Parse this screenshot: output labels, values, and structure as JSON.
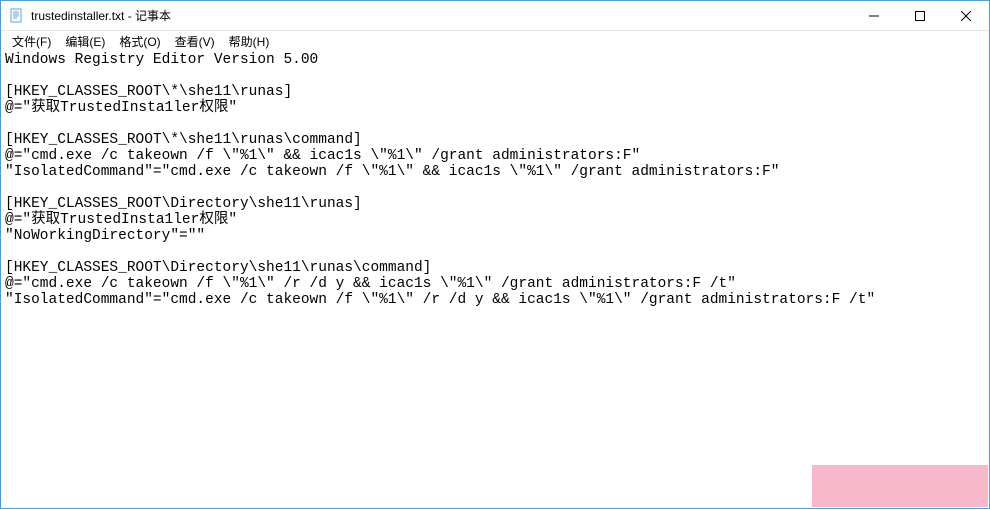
{
  "window": {
    "title": "trustedinstaller.txt - 记事本"
  },
  "menu": {
    "file": "文件(F)",
    "edit": "编辑(E)",
    "format": "格式(O)",
    "view": "查看(V)",
    "help": "帮助(H)"
  },
  "editor": {
    "content": "Windows Registry Editor Version 5.00\n\n[HKEY_CLASSES_ROOT\\*\\she11\\runas]\n@=\"获取TrustedInsta1ler权限\"\n\n[HKEY_CLASSES_ROOT\\*\\she11\\runas\\command]\n@=\"cmd.exe /c takeown /f \\\"%1\\\" && icac1s \\\"%1\\\" /grant administrators:F\"\n\"IsolatedCommand\"=\"cmd.exe /c takeown /f \\\"%1\\\" && icac1s \\\"%1\\\" /grant administrators:F\"\n\n[HKEY_CLASSES_ROOT\\Directory\\she11\\runas]\n@=\"获取TrustedInsta1ler权限\"\n\"NoWorkingDirectory\"=\"\"\n\n[HKEY_CLASSES_ROOT\\Directory\\she11\\runas\\command]\n@=\"cmd.exe /c takeown /f \\\"%1\\\" /r /d y && icac1s \\\"%1\\\" /grant administrators:F /t\"\n\"IsolatedCommand\"=\"cmd.exe /c takeown /f \\\"%1\\\" /r /d y && icac1s \\\"%1\\\" /grant administrators:F /t\""
  }
}
